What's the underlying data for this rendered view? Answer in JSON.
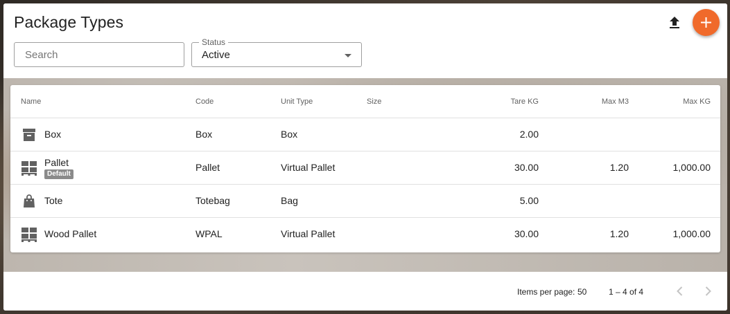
{
  "page": {
    "title": "Package Types"
  },
  "filters": {
    "search_placeholder": "Search",
    "status_label": "Status",
    "status_value": "Active"
  },
  "actions": {
    "upload_icon": "upload-icon",
    "add_icon": "add-icon",
    "accent_color": "#f06a2b"
  },
  "table": {
    "columns": [
      "Name",
      "Code",
      "Unit Type",
      "Size",
      "Tare KG",
      "Max M3",
      "Max KG"
    ],
    "rows": [
      {
        "icon": "archive-box-icon",
        "name": "Box",
        "badge": "",
        "code": "Box",
        "unit_type": "Box",
        "size": "",
        "tare_kg": "2.00",
        "max_m3": "",
        "max_kg": ""
      },
      {
        "icon": "pallet-icon",
        "name": "Pallet",
        "badge": "Default",
        "code": "Pallet",
        "unit_type": "Virtual Pallet",
        "size": "",
        "tare_kg": "30.00",
        "max_m3": "1.20",
        "max_kg": "1,000.00"
      },
      {
        "icon": "shopping-bag-icon",
        "name": "Tote",
        "badge": "",
        "code": "Totebag",
        "unit_type": "Bag",
        "size": "",
        "tare_kg": "5.00",
        "max_m3": "",
        "max_kg": ""
      },
      {
        "icon": "pallet-icon",
        "name": "Wood Pallet",
        "badge": "",
        "code": "WPAL",
        "unit_type": "Virtual Pallet",
        "size": "",
        "tare_kg": "30.00",
        "max_m3": "1.20",
        "max_kg": "1,000.00"
      }
    ]
  },
  "paginator": {
    "items_per_page_label": "Items per page:",
    "items_per_page_value": "50",
    "range_label": "1 – 4 of 4"
  }
}
